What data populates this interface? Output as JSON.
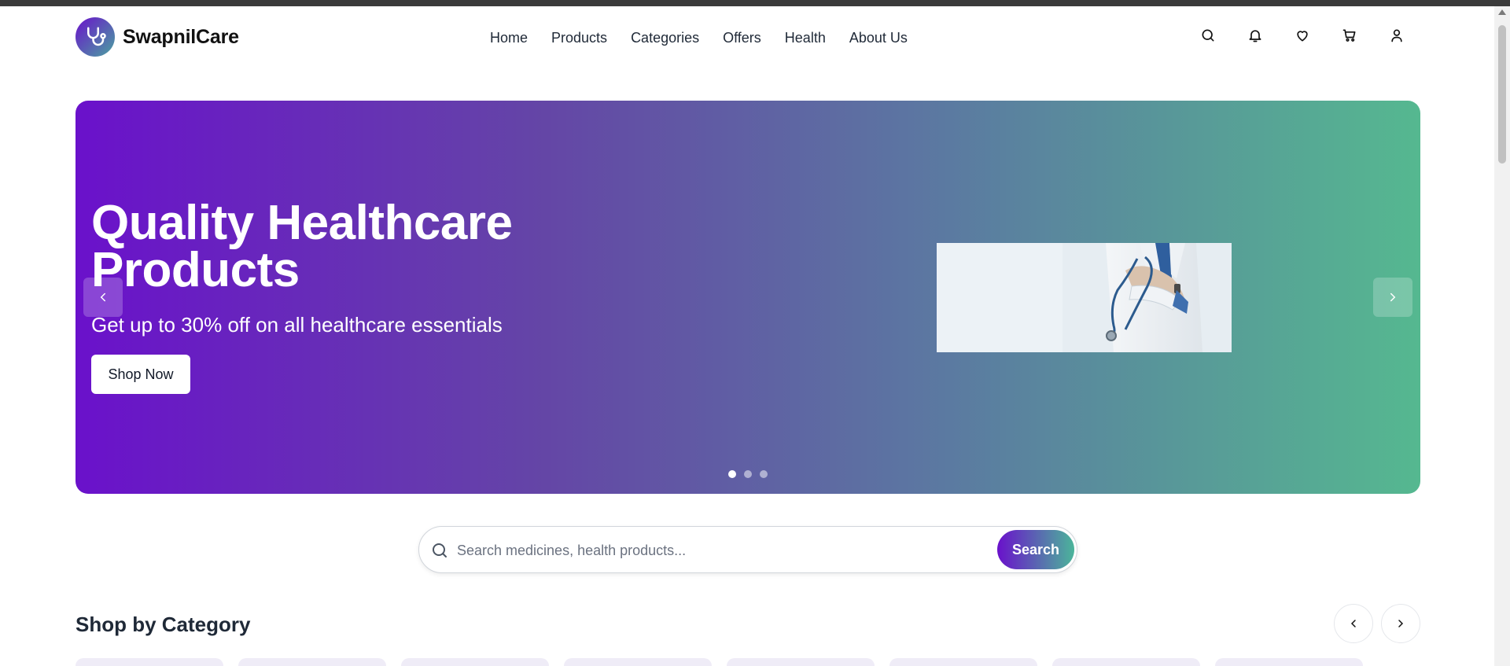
{
  "brand": {
    "name": "SwapnilCare",
    "logo_icon": "stethoscope-icon",
    "gradient_start": "#6a11cb",
    "gradient_end": "#55b890"
  },
  "nav": {
    "items": [
      {
        "label": "Home"
      },
      {
        "label": "Products"
      },
      {
        "label": "Categories"
      },
      {
        "label": "Offers"
      },
      {
        "label": "Health"
      },
      {
        "label": "About Us"
      }
    ]
  },
  "header_icons": [
    "search-icon",
    "bell-icon",
    "heart-icon",
    "cart-icon",
    "user-icon"
  ],
  "hero": {
    "title_line1": "Quality Healthcare",
    "title_line2": "Products",
    "subtitle": "Get up to 30% off on all healthcare essentials",
    "cta": "Shop Now",
    "slides_count": 3,
    "active_slide": 1
  },
  "search": {
    "placeholder": "Search medicines, health products...",
    "value": "",
    "button": "Search"
  },
  "categories": {
    "title": "Shop by Category",
    "card_count": 8
  }
}
